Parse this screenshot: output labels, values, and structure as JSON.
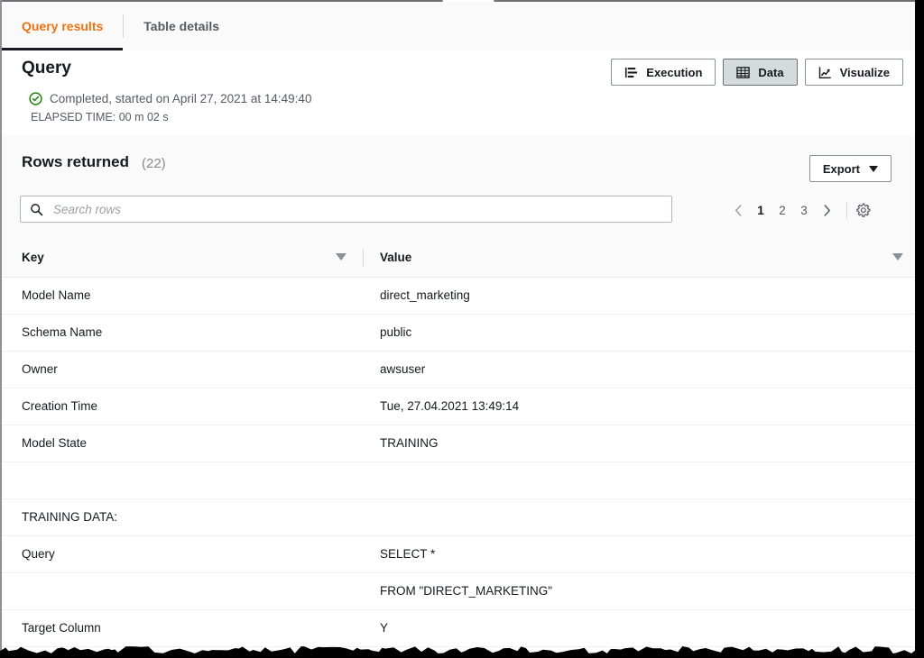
{
  "tabs": [
    {
      "label": "Query results",
      "active": true
    },
    {
      "label": "Table details",
      "active": false
    }
  ],
  "query": {
    "title": "Query",
    "status": "Completed, started on April 27, 2021 at 14:49:40",
    "elapsed": "ELAPSED TIME: 00 m 02 s",
    "status_icon": "check-circle-icon",
    "status_color": "#1d8102"
  },
  "view_buttons": [
    {
      "label": "Execution",
      "icon": "execution-list-icon",
      "selected": false
    },
    {
      "label": "Data",
      "icon": "table-grid-icon",
      "selected": true
    },
    {
      "label": "Visualize",
      "icon": "line-chart-icon",
      "selected": false
    }
  ],
  "rows_section": {
    "title": "Rows returned",
    "count": "(22)",
    "export_label": "Export",
    "export_caret": "chevron-down-icon"
  },
  "search": {
    "placeholder": "Search rows",
    "value": "",
    "icon": "search-icon"
  },
  "pagination": {
    "prev_icon": "chevron-left-icon",
    "next_icon": "chevron-right-icon",
    "pages": [
      "1",
      "2",
      "3"
    ],
    "current": "1",
    "settings_icon": "gear-icon"
  },
  "table": {
    "columns": [
      {
        "label": "Key",
        "sort_icon": "sort-descending-icon"
      },
      {
        "label": "Value",
        "sort_icon": "sort-descending-icon"
      }
    ],
    "rows": [
      {
        "key": "Model Name",
        "value": "direct_marketing"
      },
      {
        "key": "Schema Name",
        "value": "public"
      },
      {
        "key": "Owner",
        "value": "awsuser"
      },
      {
        "key": "Creation Time",
        "value": "Tue, 27.04.2021 13:49:14"
      },
      {
        "key": "Model State",
        "value": "TRAINING"
      },
      {
        "key": "",
        "value": ""
      },
      {
        "key": "TRAINING DATA:",
        "value": ""
      },
      {
        "key": "Query",
        "value": "SELECT *"
      },
      {
        "key": "",
        "value": "FROM \"DIRECT_MARKETING\""
      },
      {
        "key": "Target Column",
        "value": "Y"
      }
    ]
  },
  "theme": {
    "accent_orange": "#ec7211",
    "text_dark": "#16191f",
    "text_muted": "#545b64",
    "border": "#e4e6e8",
    "panel_bg": "#fafafa"
  }
}
